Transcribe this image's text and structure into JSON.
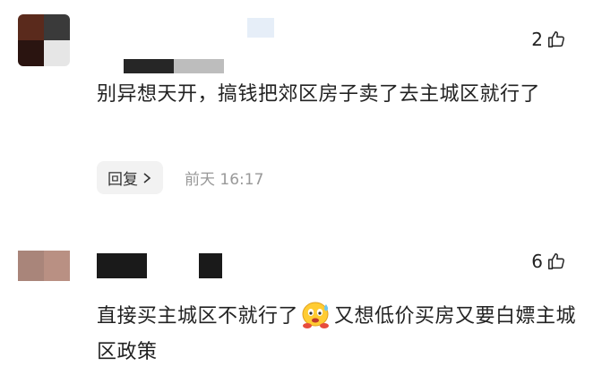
{
  "comments": [
    {
      "likes": "2",
      "text": "别异想天开，搞钱把郊区房子卖了去主城区就行了",
      "reply_label": "回复",
      "time": "前天  16:17"
    },
    {
      "likes": "6",
      "text_before": "直接买主城区不就行了",
      "text_after": "又想低价买房又要白嫖主城区政策"
    }
  ],
  "icons": {
    "like": "thumbs-up-icon",
    "reply_chevron": "chevron-right-icon",
    "emoji": "sweat-face-emoji"
  }
}
